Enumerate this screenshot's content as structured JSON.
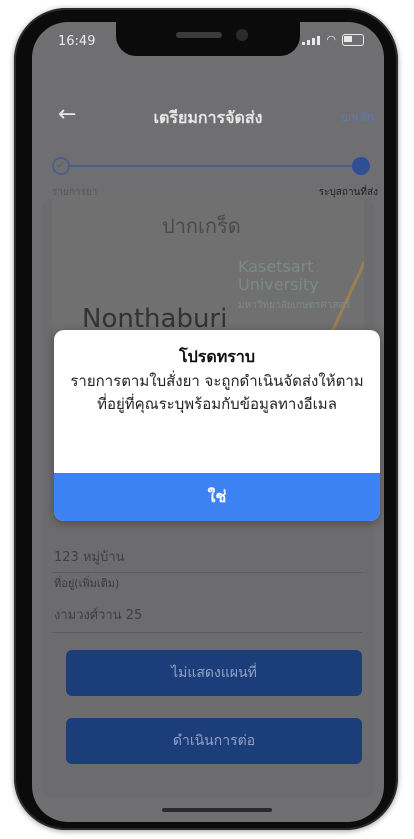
{
  "status_bar": {
    "time": "16:49"
  },
  "header": {
    "back": "←",
    "title": "เตรียมการจัดส่ง",
    "cancel": "ยกเลิก"
  },
  "stepper": {
    "step1_label": "รายการยา",
    "step2_label": "ระบุสถานที่ส่ง",
    "done_mark": "✓"
  },
  "map": {
    "label_top": "ปากเกร็ด",
    "label_univ_en": "Kasetsart University",
    "label_univ_th": "มหาวิทยาลัยเกษตรศาสตร์",
    "label_province": "Nonthaburi"
  },
  "form": {
    "address_value": "123 หมู่บ้าน",
    "extra_label": "ที่อยู่(เพิ่มเติม)",
    "extra_value": "งามวงศ์วาน 25"
  },
  "buttons": {
    "hide_map": "ไม่แสดงแผนที่",
    "continue": "ดำเนินการต่อ"
  },
  "dialog": {
    "title": "โปรดทราบ",
    "message": "รายการตามใบสั่งยา จะถูกดำเนินจัดส่งให้ตามที่อยู่ที่คุณระบุพร้อมกับข้อมูลทางอีเมล",
    "confirm": "ใช่"
  },
  "colors": {
    "dialog_button": "#3d82f2",
    "primary_dark": "#1b3d7a",
    "overlay": "#6f6f71"
  }
}
